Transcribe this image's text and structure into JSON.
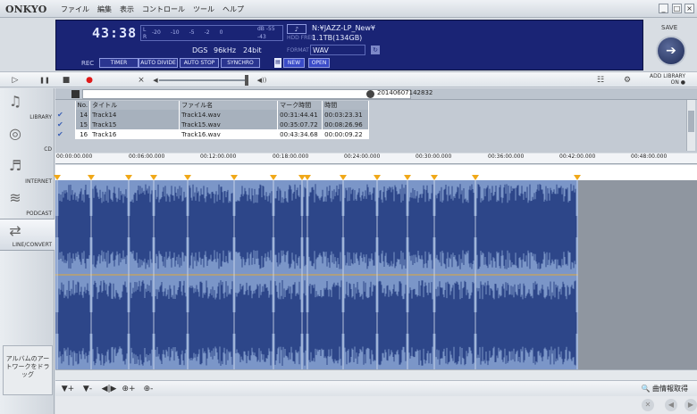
{
  "app": {
    "logo": "ONKYO"
  },
  "menu": [
    "ファイル",
    "編集",
    "表示",
    "コントロール",
    "ツール",
    "ヘルプ"
  ],
  "window_controls": {
    "minimize": "_",
    "maximize": "□",
    "close": "×"
  },
  "display": {
    "time": "43:38",
    "meter_scale": [
      "-20",
      "-10",
      "-5",
      "-2",
      "0"
    ],
    "meter_channels": [
      "L",
      "R"
    ],
    "db_top": "dB -55",
    "db_bottom": "-43",
    "folder_icon": "♪",
    "hdd_label": "HDD FREE",
    "path": "N:¥JAZZ-LP_New¥",
    "capacity": "1.1TB(134GB)",
    "dgs": "DGS",
    "sample_rate": "96kHz",
    "bit_depth": "24bit",
    "format_label": "FORMAT",
    "format": "WAV",
    "rec_label": "REC",
    "buttons": [
      "TIMER",
      "AUTO DIVIDE",
      "AUTO STOP",
      "SYNCHRO"
    ],
    "new_label": "NEW",
    "open_label": "OPEN"
  },
  "save": {
    "label": "SAVE",
    "icon": "➔"
  },
  "transport": {
    "play": "▷",
    "pause": "❚❚",
    "stop": "■",
    "record": "●",
    "mute": "⨯",
    "vol_min": "◀",
    "vol_max": "◀))",
    "add_library": "ADD LIBRARY",
    "add_library_state": "ON"
  },
  "sidebar": {
    "items": [
      {
        "label": "LIBRARY",
        "icon": "♫"
      },
      {
        "label": "CD",
        "icon": "◎"
      },
      {
        "label": "INTERNET",
        "icon": "♬"
      },
      {
        "label": "PODCAST",
        "icon": "≋"
      },
      {
        "label": "LINE/CONVERT",
        "icon": "⇄"
      }
    ],
    "artwork": "アルバムのアートワークをドラッグ"
  },
  "playlist": {
    "date": "20140607142832",
    "headers": [
      "No.",
      "タイトル",
      "ファイル名",
      "マーク時間",
      "時間"
    ],
    "rows": [
      {
        "check": "✔",
        "no": "14",
        "title": "Track14",
        "file": "Track14.wav",
        "mark": "00:31:44.41",
        "time": "00:03:23.31",
        "selected": false
      },
      {
        "check": "✔",
        "no": "15",
        "title": "Track15",
        "file": "Track15.wav",
        "mark": "00:35:07.72",
        "time": "00:08:26.96",
        "selected": false
      },
      {
        "check": "✔",
        "no": "16",
        "title": "Track16",
        "file": "Track16.wav",
        "mark": "00:43:34.68",
        "time": "00:00:09.22",
        "selected": true
      }
    ]
  },
  "timeline": {
    "ticks": [
      "00:00:00.000",
      "00:06:00.000",
      "00:12:00.000",
      "00:18:00.000",
      "00:24:00.000",
      "00:30:00.000",
      "00:36:00.000",
      "00:42:00.000",
      "00:48:00.000"
    ]
  },
  "bottombar": {
    "tools": [
      "▼+",
      "▼-",
      "◀|▶",
      "⊕+",
      "⊕-"
    ],
    "fetch": "曲情報取得",
    "fetch_icon": "🔍"
  },
  "colors": {
    "lcd": "#1a2475",
    "wave": "#2d4689",
    "wave_bg": "#7b96c8",
    "marker": "#f0a818"
  }
}
